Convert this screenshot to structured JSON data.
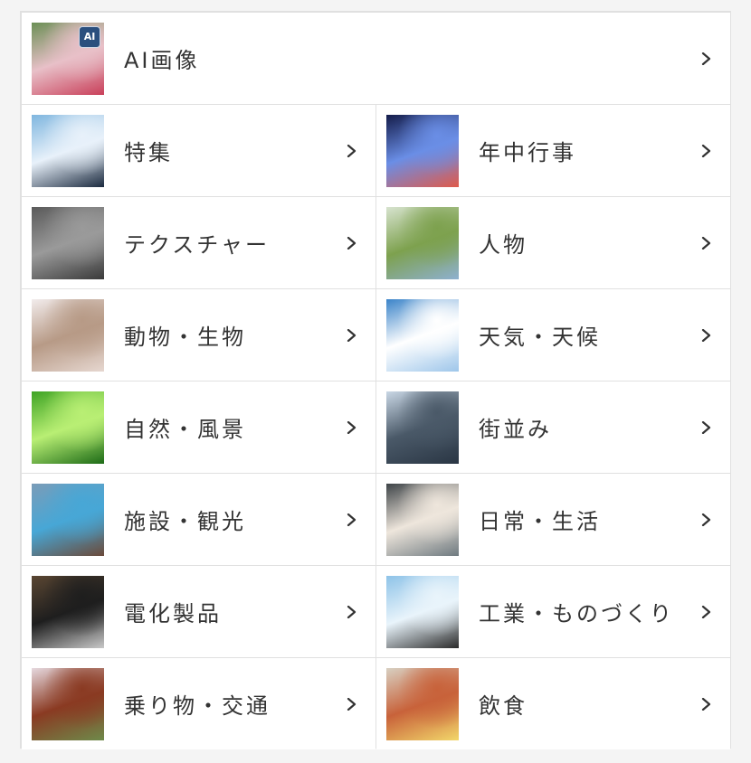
{
  "categories": [
    {
      "label": "AI画像",
      "icon": "ai-image-thumbnail",
      "badge": "AI",
      "colors": [
        "#6b8f55",
        "#e8c0c8",
        "#c9405a"
      ]
    },
    {
      "label": "特集",
      "icon": "feature-sky-thumbnail",
      "colors": [
        "#7fb6df",
        "#e8f1fa",
        "#1b2a3f"
      ]
    },
    {
      "label": "年中行事",
      "icon": "fireworks-thumbnail",
      "colors": [
        "#141c4a",
        "#6a8ee6",
        "#e05a4a"
      ]
    },
    {
      "label": "テクスチャー",
      "icon": "metal-plate-thumbnail",
      "colors": [
        "#5a5a5a",
        "#9a9a9a",
        "#3a3a3a"
      ]
    },
    {
      "label": "人物",
      "icon": "couple-walking-thumbnail",
      "colors": [
        "#d7e3cf",
        "#7da14e",
        "#8eb0d0"
      ]
    },
    {
      "label": "動物・生物",
      "icon": "hedgehog-thumbnail",
      "colors": [
        "#f2ecec",
        "#b79a86",
        "#e6d7d0"
      ]
    },
    {
      "label": "天気・天候",
      "icon": "clouds-sky-thumbnail",
      "colors": [
        "#3b84c9",
        "#ffffff",
        "#9ec6ea"
      ]
    },
    {
      "label": "自然・風景",
      "icon": "green-leaves-thumbnail",
      "colors": [
        "#3ea324",
        "#b9ef74",
        "#1d6b17"
      ]
    },
    {
      "label": "街並み",
      "icon": "city-skyline-thumbnail",
      "colors": [
        "#c9d7e5",
        "#4a5968",
        "#2a3644"
      ]
    },
    {
      "label": "施設・観光",
      "icon": "hot-spring-thumbnail",
      "colors": [
        "#7a9cb8",
        "#47a7d6",
        "#6b4a3a"
      ]
    },
    {
      "label": "日常・生活",
      "icon": "book-desk-thumbnail",
      "colors": [
        "#3e4448",
        "#eee6dc",
        "#6f7a80"
      ]
    },
    {
      "label": "電化製品",
      "icon": "smartphones-thumbnail",
      "colors": [
        "#5a4632",
        "#1e1e1e",
        "#c8c8c8"
      ]
    },
    {
      "label": "工業・ものづくり",
      "icon": "cranes-thumbnail",
      "colors": [
        "#8ec3e8",
        "#e9f4fb",
        "#2b2b2b"
      ]
    },
    {
      "label": "乗り物・交通",
      "icon": "train-cherry-thumbnail",
      "colors": [
        "#e6d9df",
        "#8a3a22",
        "#6e8a4a"
      ]
    },
    {
      "label": "飲食",
      "icon": "pizza-wine-thumbnail",
      "colors": [
        "#d8d0c2",
        "#c8623a",
        "#f2d76a"
      ]
    }
  ],
  "chevron_icon": "chevron-right-icon"
}
